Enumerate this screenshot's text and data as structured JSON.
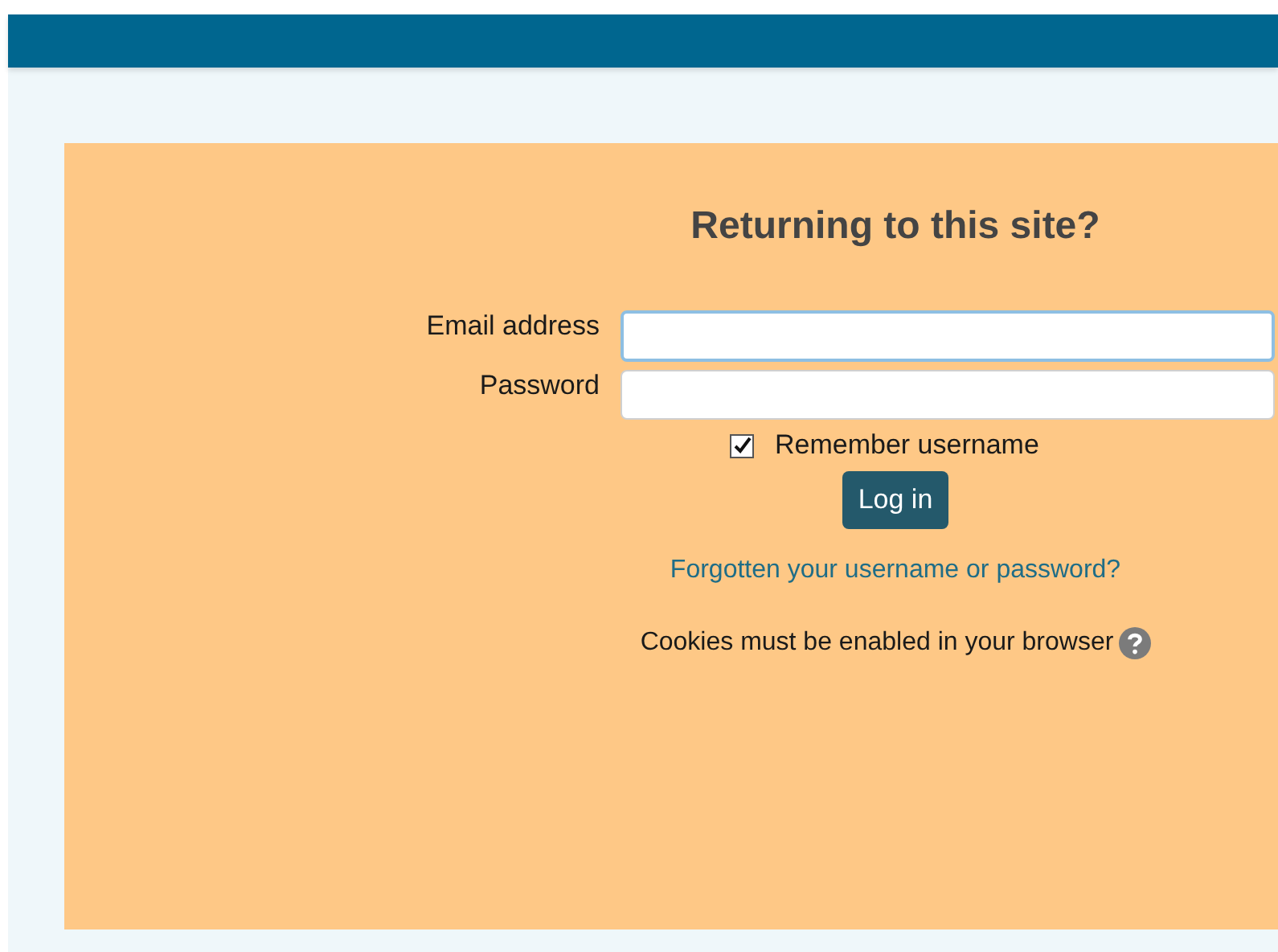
{
  "login": {
    "title": "Returning to this site?",
    "fields": [
      {
        "label": "Email address",
        "focused": true
      },
      {
        "label": "Password",
        "focused": false
      }
    ],
    "remember": {
      "label": "Remember username",
      "checked": true
    },
    "submit": "Log in",
    "forgot_link": "Forgotten your username or password?",
    "cookies_note": "Cookies must be enabled in your browser"
  }
}
